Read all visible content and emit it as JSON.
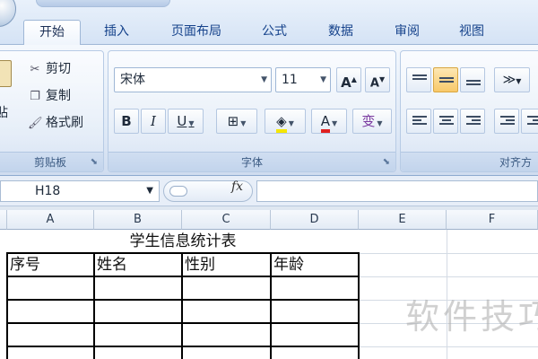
{
  "ribbon": {
    "tabs": [
      {
        "label": "开始",
        "active": true
      },
      {
        "label": "插入"
      },
      {
        "label": "页面布局"
      },
      {
        "label": "公式"
      },
      {
        "label": "数据"
      },
      {
        "label": "审阅"
      },
      {
        "label": "视图"
      }
    ],
    "clipboard": {
      "paste_label": "贴",
      "cut_label": "剪切",
      "copy_label": "复制",
      "format_painter_label": "格式刷",
      "group_label": "剪贴板"
    },
    "font": {
      "font_name": "宋体",
      "font_size": "11",
      "grow_label": "A",
      "shrink_label": "A",
      "bold_label": "B",
      "italic_label": "I",
      "underline_label": "U",
      "font_color_label": "A",
      "phonetic_label": "变",
      "group_label": "字体"
    },
    "alignment": {
      "group_label": "对齐方"
    }
  },
  "formula_bar": {
    "cell_ref": "H18",
    "fx_label": "fx",
    "value": ""
  },
  "sheet": {
    "columns": [
      "A",
      "B",
      "C",
      "D",
      "E",
      "F"
    ],
    "title": "学生信息统计表",
    "headers": [
      "序号",
      "姓名",
      "性别",
      "年龄"
    ]
  },
  "watermark": "软件技巧",
  "colors": {
    "ribbon_tab_text": "#15428b",
    "active_align": "#f8c96a",
    "font_color_bar": "#e02020",
    "fill_color_bar": "#f5e600"
  }
}
